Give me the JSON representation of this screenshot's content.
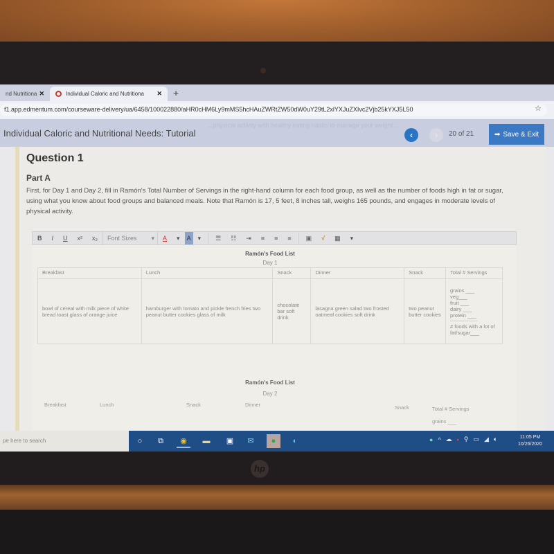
{
  "browser": {
    "tabs": [
      {
        "label": "nd Nutritiona",
        "active": false
      },
      {
        "label": "Individual Caloric and Nutritiona",
        "active": true
      }
    ],
    "new_tab": "+",
    "close_glyph": "✕",
    "url": "f1.app.edmentum.com/courseware-delivery/ua/6458/100022880/aHR0cHM6Ly9mMS5hcHAuZWRtZW50dW0uY29tL2xlYXJuZXIvc2Vjb25kYXJ5L50",
    "bookmark_icon": "☆"
  },
  "app": {
    "title": "Individual Caloric and Nutritional Needs: Tutorial",
    "ghost_text": "...physical activity with healthy eating habits to manage your weight...",
    "prev_glyph": "‹",
    "next_glyph": "›",
    "page_current": "20",
    "page_of": "of",
    "page_total": "21",
    "save_exit": "Save & Exit"
  },
  "question": {
    "title": "Question 1",
    "part": "Part A",
    "prompt": "First, for Day 1 and Day 2, fill in Ramón's Total Number of Servings in the right-hand column for each food group, as well as the number of foods high in fat or sugar, using what you know about food groups and balanced meals. Note that Ramón is 17, 5 feet, 8 inches tall, weighs 165 pounds, and engages in moderate levels of physical activity."
  },
  "toolbar": {
    "bold": "B",
    "italic": "I",
    "underline": "U",
    "superscript": "x²",
    "subscript": "x₂",
    "font_sizes": "Font Sizes",
    "dropdown": "▾",
    "font_color": "A",
    "bg_color": "A",
    "bullets": "☰",
    "numbered": "☷",
    "indent": "⇥",
    "align_left": "≡",
    "align_center": "≡",
    "align_right": "≡",
    "image": "▣",
    "math": "√",
    "table": "▦"
  },
  "day1": {
    "caption": "Ramón's Food List",
    "day": "Day 1",
    "headers": [
      "Breakfast",
      "Lunch",
      "Snack",
      "Dinner",
      "Snack",
      "Total # Servings"
    ],
    "meals": [
      "bowl of cereal with milk piece of white bread toast glass of orange juice",
      "hamburger with tomato and pickle french fries two peanut butter cookies glass of milk",
      "chocolate bar soft drink",
      "lasagna green salad two frosted oatmeal cookies soft drink",
      "two peanut butter cookies"
    ],
    "totals": [
      "grains ___",
      "veg___",
      "fruit ___",
      "dairy ___",
      "protein ___"
    ],
    "fat_sugar": "# foods with a lot of fat/sugar___"
  },
  "day2": {
    "caption": "Ramón's Food List",
    "day": "Day 2",
    "headers": [
      "Breakfast",
      "Lunch",
      "Snack",
      "Dinner",
      "Snack",
      "Total # Servings"
    ],
    "totals_first": "grains ___"
  },
  "taskbar": {
    "search_placeholder": "pe here to search",
    "time": "11:05 PM",
    "date": "10/26/2020"
  },
  "laptop": {
    "logo": "hp"
  }
}
